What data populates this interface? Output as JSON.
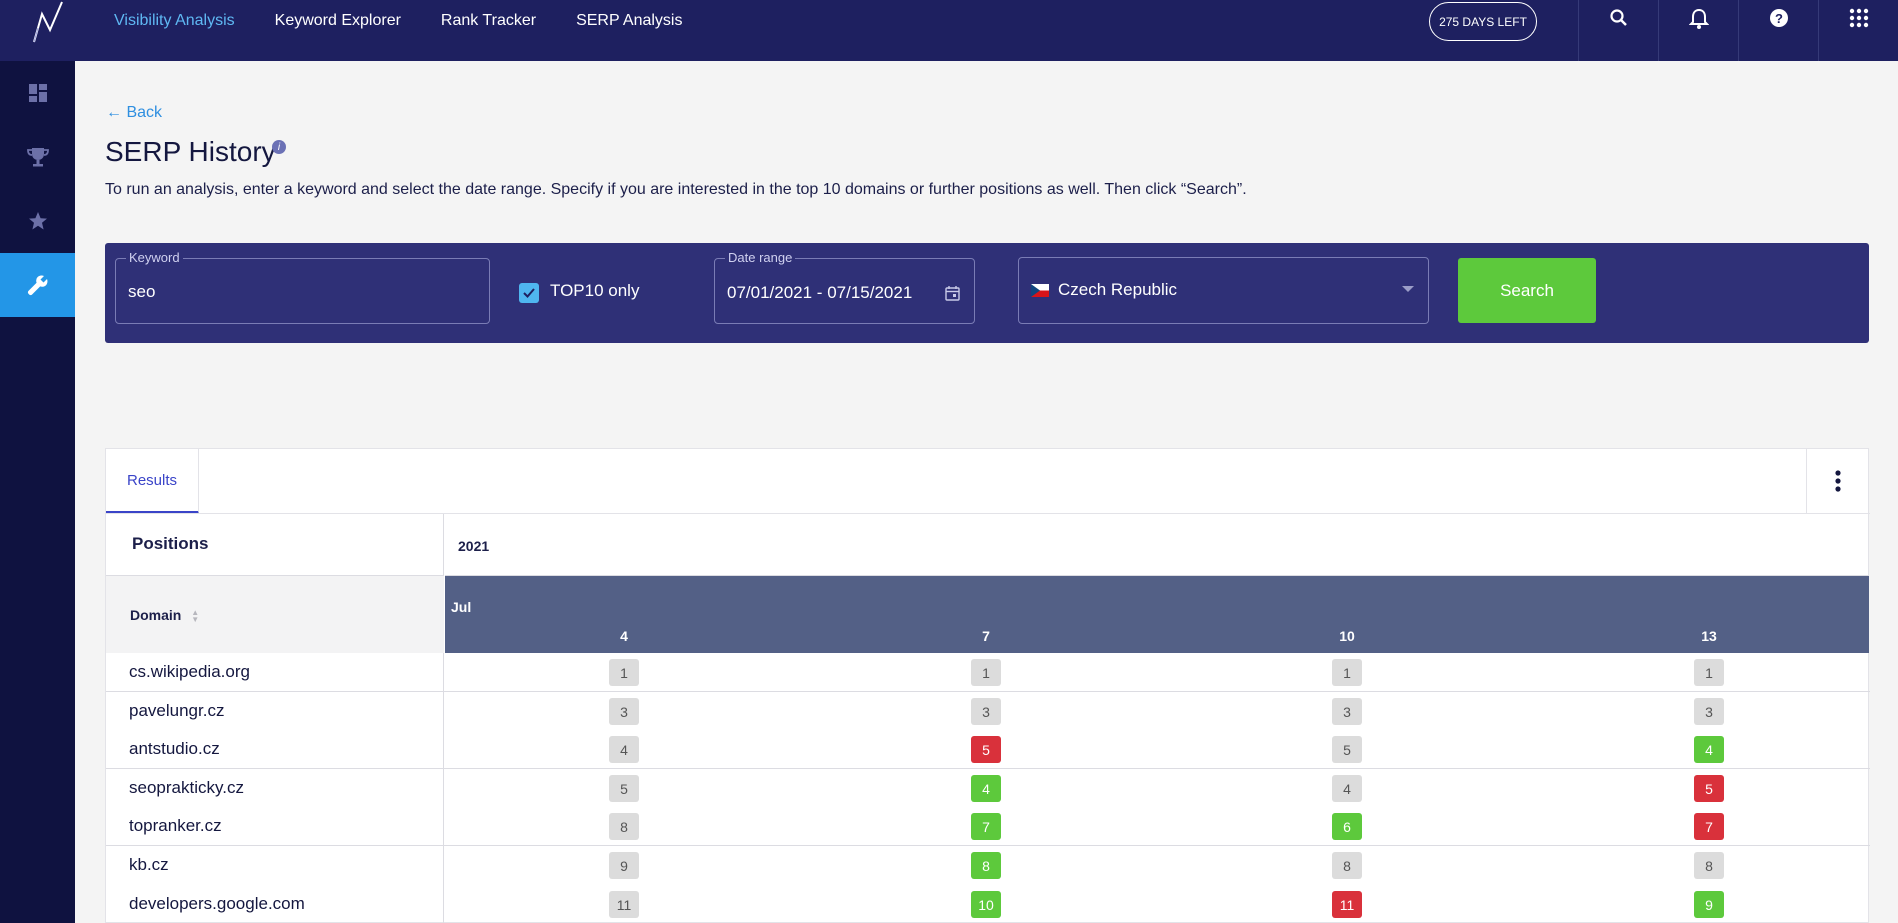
{
  "nav": {
    "items": [
      {
        "label": "Visibility Analysis",
        "active": true
      },
      {
        "label": "Keyword Explorer",
        "active": false
      },
      {
        "label": "Rank Tracker",
        "active": false
      },
      {
        "label": "SERP Analysis",
        "active": false
      }
    ],
    "days_left": "275 DAYS LEFT"
  },
  "page": {
    "back_label": "← Back",
    "title": "SERP History",
    "description": "To run an analysis, enter a keyword and select the date range. Specify if you are interested in the top 10 domains or further positions as well. Then click “Search”."
  },
  "search": {
    "keyword_label": "Keyword",
    "keyword_value": "seo",
    "top10_label": "TOP10 only",
    "top10_checked": true,
    "date_label": "Date range",
    "date_value": "07/01/2021 - 07/15/2021",
    "country": "Czech Republic",
    "button_label": "Search"
  },
  "results": {
    "tab_label": "Results",
    "positions_label": "Positions",
    "domain_label": "Domain",
    "year": "2021",
    "month": "Jul",
    "days": [
      "4",
      "7",
      "10",
      "13"
    ],
    "rows": [
      {
        "domain": "cs.wikipedia.org",
        "positions": [
          [
            "1",
            "gray"
          ],
          [
            "1",
            "gray"
          ],
          [
            "1",
            "gray"
          ],
          [
            "1",
            "gray"
          ]
        ]
      },
      {
        "domain": "pavelungr.cz",
        "positions": [
          [
            "3",
            "gray"
          ],
          [
            "3",
            "gray"
          ],
          [
            "3",
            "gray"
          ],
          [
            "3",
            "gray"
          ]
        ]
      },
      {
        "domain": "antstudio.cz",
        "positions": [
          [
            "4",
            "gray"
          ],
          [
            "5",
            "red"
          ],
          [
            "5",
            "gray"
          ],
          [
            "4",
            "green"
          ]
        ]
      },
      {
        "domain": "seoprakticky.cz",
        "positions": [
          [
            "5",
            "gray"
          ],
          [
            "4",
            "green"
          ],
          [
            "4",
            "gray"
          ],
          [
            "5",
            "red"
          ]
        ]
      },
      {
        "domain": "topranker.cz",
        "positions": [
          [
            "8",
            "gray"
          ],
          [
            "7",
            "green"
          ],
          [
            "6",
            "green"
          ],
          [
            "7",
            "red"
          ]
        ]
      },
      {
        "domain": "kb.cz",
        "positions": [
          [
            "9",
            "gray"
          ],
          [
            "8",
            "green"
          ],
          [
            "8",
            "gray"
          ],
          [
            "8",
            "gray"
          ]
        ]
      },
      {
        "domain": "developers.google.com",
        "positions": [
          [
            "11",
            "gray"
          ],
          [
            "10",
            "green"
          ],
          [
            "11",
            "red"
          ],
          [
            "9",
            "green"
          ]
        ]
      }
    ]
  },
  "colors": {
    "topbar": "#1e2060",
    "sidebar": "#0f1240",
    "accent_blue": "#2396e7",
    "panel": "#2f3077",
    "green": "#5dc93c",
    "red": "#d9313b"
  }
}
